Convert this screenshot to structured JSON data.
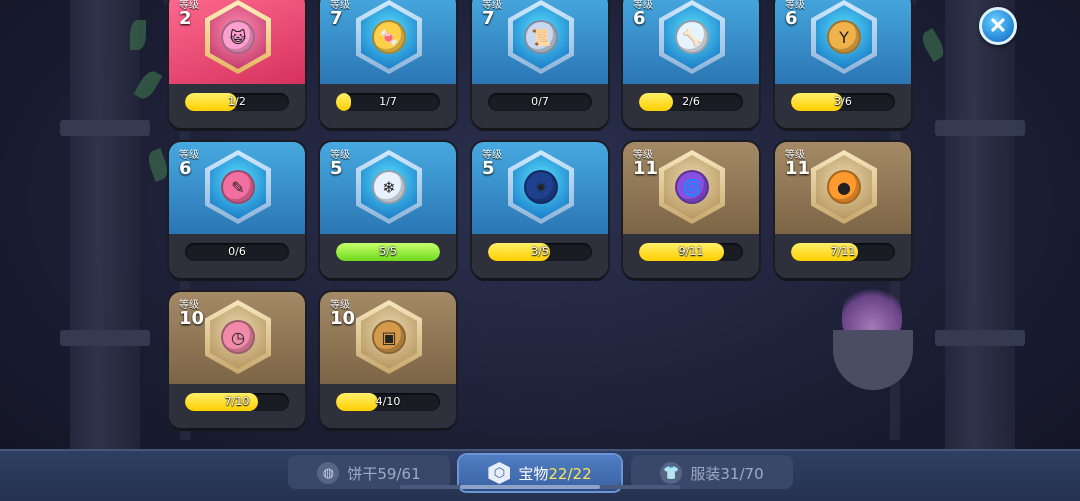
{
  "level_label": "等级",
  "close_icon": "close-x-icon",
  "treasures": [
    {
      "level": "2",
      "progress": "1/2",
      "fill": 0.5,
      "theme": "pink",
      "bar": "yellow",
      "icon": "cat-goggles-icon",
      "color": "#ff9fd0"
    },
    {
      "level": "7",
      "progress": "1/7",
      "fill": 0.14,
      "theme": "blue",
      "bar": "yellow",
      "icon": "candy-icon",
      "color": "#ffd04a"
    },
    {
      "level": "7",
      "progress": "0/7",
      "fill": 0,
      "theme": "blue",
      "bar": "yellow",
      "icon": "scroll-icon",
      "color": "#c9d8f0"
    },
    {
      "level": "6",
      "progress": "2/6",
      "fill": 0.33,
      "theme": "blue",
      "bar": "yellow",
      "icon": "bone-hook-icon",
      "color": "#e6f4ff"
    },
    {
      "level": "6",
      "progress": "3/6",
      "fill": 0.5,
      "theme": "blue",
      "bar": "yellow",
      "icon": "slingshot-icon",
      "color": "#f0b24a"
    },
    {
      "level": "6",
      "progress": "0/6",
      "fill": 0,
      "theme": "blue",
      "bar": "yellow",
      "icon": "note-feather-icon",
      "color": "#f26fa0"
    },
    {
      "level": "5",
      "progress": "5/5",
      "fill": 1,
      "theme": "blue",
      "bar": "green",
      "icon": "snow-orb-icon",
      "color": "#e8f1ff"
    },
    {
      "level": "5",
      "progress": "3/5",
      "fill": 0.6,
      "theme": "blue",
      "bar": "yellow",
      "icon": "spiky-shell-icon",
      "color": "#1f3f8f"
    },
    {
      "level": "11",
      "progress": "9/11",
      "fill": 0.82,
      "theme": "brown",
      "bar": "yellow",
      "icon": "purple-swirl-icon",
      "color": "#8b4fe0"
    },
    {
      "level": "11",
      "progress": "7/11",
      "fill": 0.64,
      "theme": "brown",
      "bar": "yellow",
      "icon": "orange-pouch-icon",
      "color": "#ff9a2e"
    },
    {
      "level": "10",
      "progress": "7/10",
      "fill": 0.7,
      "theme": "brown",
      "bar": "yellow",
      "icon": "pocket-watch-icon",
      "color": "#f08aa8"
    },
    {
      "level": "10",
      "progress": "4/10",
      "fill": 0.4,
      "theme": "brown",
      "bar": "yellow",
      "icon": "treasure-chest-icon",
      "color": "#d49a4a"
    }
  ],
  "tabs": [
    {
      "label": "饼干",
      "count": "59/61",
      "active": false,
      "icon": "cookie-icon"
    },
    {
      "label": "宝物",
      "count": "22/22",
      "active": true,
      "icon": "treasure-hex-icon"
    },
    {
      "label": "服装",
      "count": "31/70",
      "active": false,
      "icon": "shirt-icon"
    }
  ]
}
